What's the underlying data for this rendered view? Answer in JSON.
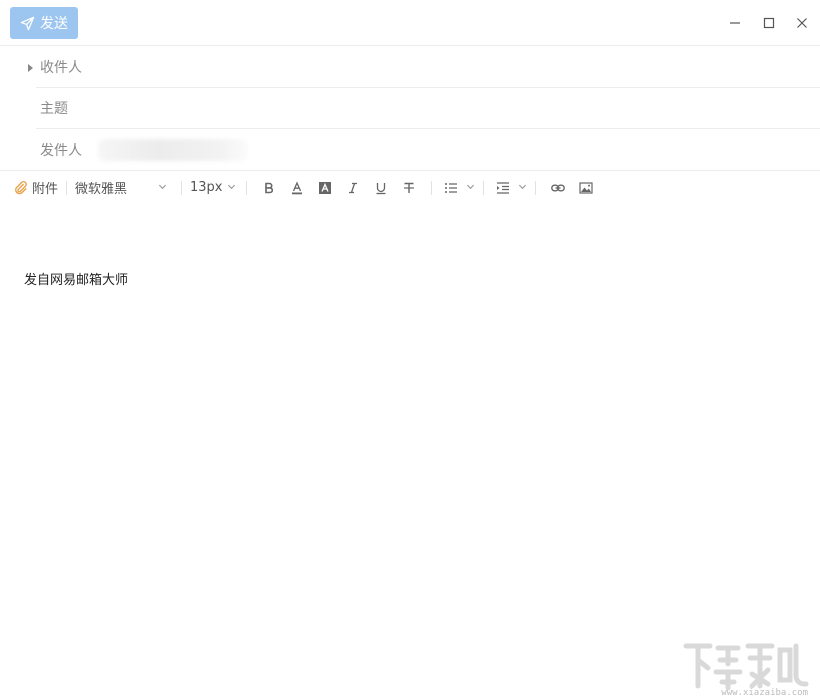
{
  "titlebar": {
    "send_label": "发送"
  },
  "fields": {
    "recipient_label": "收件人",
    "subject_label": "主题",
    "sender_label": "发件人"
  },
  "toolbar": {
    "attach_label": "附件",
    "font_family": "微软雅黑",
    "font_size": "13px"
  },
  "editor": {
    "signature": "发自网易邮箱大师"
  },
  "watermark": {
    "text": "www.xiazaiba.com"
  },
  "colors": {
    "send_button": "#9cc6ef",
    "divider": "#ececec",
    "attach_icon": "#e6a24a"
  },
  "icons": {
    "send": "paper-plane-icon",
    "minimize": "minimize-icon",
    "maximize": "maximize-icon",
    "close": "close-icon",
    "attach": "paperclip-icon"
  }
}
